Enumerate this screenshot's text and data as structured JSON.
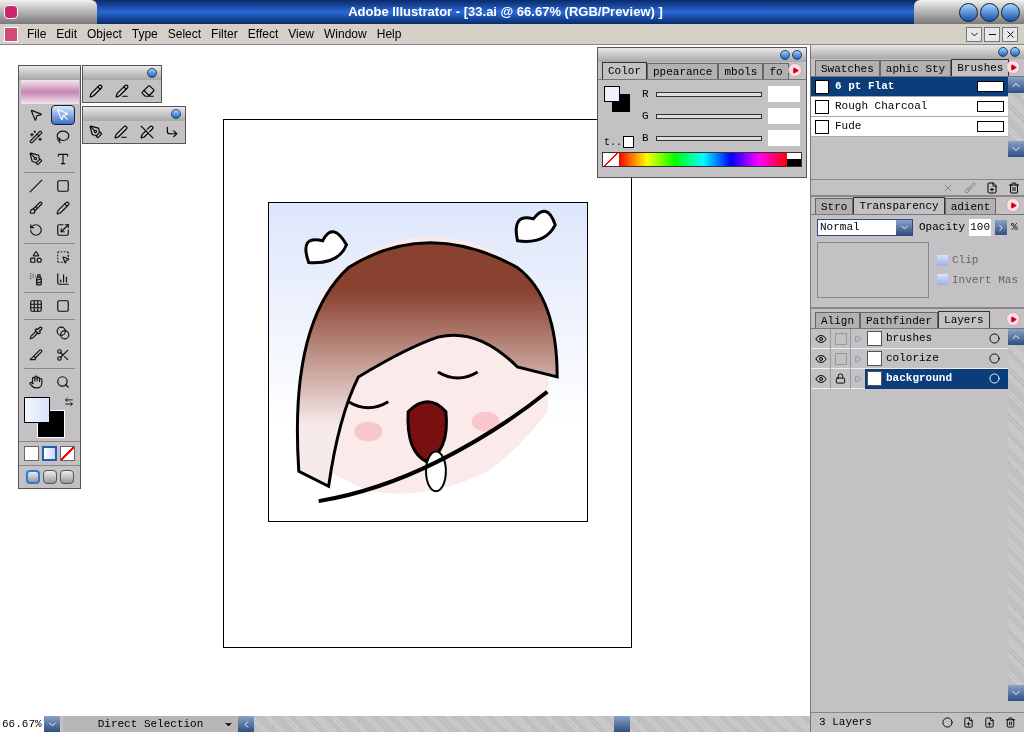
{
  "window": {
    "title": "Adobe Illustrator - [33.ai @ 66.67% (RGB/Preview) ]"
  },
  "menu": [
    "File",
    "Edit",
    "Object",
    "Type",
    "Select",
    "Filter",
    "Effect",
    "View",
    "Window",
    "Help"
  ],
  "toolbox": {
    "tools": [
      {
        "kind": "select",
        "selected": false
      },
      {
        "kind": "direct",
        "selected": true
      },
      {
        "kind": "wand",
        "selected": false
      },
      {
        "kind": "lasso",
        "selected": false
      },
      {
        "kind": "pen",
        "selected": false
      },
      {
        "kind": "type",
        "selected": false
      },
      {
        "kind": "line",
        "selected": false
      },
      {
        "kind": "rect",
        "selected": false
      },
      {
        "kind": "brush",
        "selected": false
      },
      {
        "kind": "pencil",
        "selected": false
      },
      {
        "kind": "rotate",
        "selected": false
      },
      {
        "kind": "scale",
        "selected": false
      },
      {
        "kind": "warp",
        "selected": false
      },
      {
        "kind": "free",
        "selected": false
      },
      {
        "kind": "spray",
        "selected": false
      },
      {
        "kind": "graph",
        "selected": false
      },
      {
        "kind": "mesh",
        "selected": false
      },
      {
        "kind": "gradient",
        "selected": false
      },
      {
        "kind": "eyedropper",
        "selected": false
      },
      {
        "kind": "blend",
        "selected": false
      },
      {
        "kind": "knife",
        "selected": false
      },
      {
        "kind": "scissors",
        "selected": false
      },
      {
        "kind": "hand",
        "selected": false
      },
      {
        "kind": "zoom",
        "selected": false
      }
    ],
    "fill_modes": [
      {
        "kind": "color",
        "selected": false
      },
      {
        "kind": "gradient",
        "selected": true
      },
      {
        "kind": "none",
        "selected": false
      }
    ],
    "screen_modes": [
      {
        "selected": true
      },
      {
        "selected": false
      },
      {
        "selected": false
      }
    ]
  },
  "color_panel": {
    "tabs": [
      {
        "label": "Color",
        "selected": true
      },
      {
        "label": "ppearance",
        "selected": false
      },
      {
        "label": "mbols",
        "selected": false
      },
      {
        "label": "fo",
        "selected": false
      }
    ],
    "channels": [
      {
        "label": "R",
        "level": 0
      },
      {
        "label": "G",
        "level": 0
      },
      {
        "label": "B",
        "level": 0
      }
    ],
    "swap_label": "t.."
  },
  "brushes_panel": {
    "tabs": [
      {
        "label": "Swatches",
        "selected": false
      },
      {
        "label": "aphic Sty",
        "selected": false
      },
      {
        "label": "Brushes",
        "selected": true
      }
    ],
    "brushes": [
      {
        "name": "6 pt Flat",
        "selected": true
      },
      {
        "name": "Rough Charcoal",
        "selected": false
      },
      {
        "name": "Fude",
        "selected": false
      }
    ]
  },
  "transparency_panel": {
    "tabs": [
      {
        "label": "Stro",
        "selected": false
      },
      {
        "label": "Transparency",
        "selected": true
      },
      {
        "label": "adient",
        "selected": false
      }
    ],
    "blend_mode": "Normal",
    "opacity_label": "Opacity",
    "opacity": "100",
    "percent": "%",
    "options": [
      {
        "label": "Clip",
        "checked": false
      },
      {
        "label": "Invert Mas",
        "checked": false
      }
    ]
  },
  "layers_panel": {
    "tabs": [
      {
        "label": "Align",
        "selected": false
      },
      {
        "label": "Pathfinder",
        "selected": false
      },
      {
        "label": "Layers",
        "selected": true
      }
    ],
    "layers": [
      {
        "name": "brushes",
        "visible": true,
        "locked": false,
        "selected": false
      },
      {
        "name": "colorize",
        "visible": true,
        "locked": false,
        "selected": false
      },
      {
        "name": "background",
        "visible": true,
        "locked": true,
        "selected": true
      }
    ],
    "count": "3 Layers"
  },
  "status_bar": {
    "zoom": "66.67%",
    "tool": "Direct Selection"
  }
}
